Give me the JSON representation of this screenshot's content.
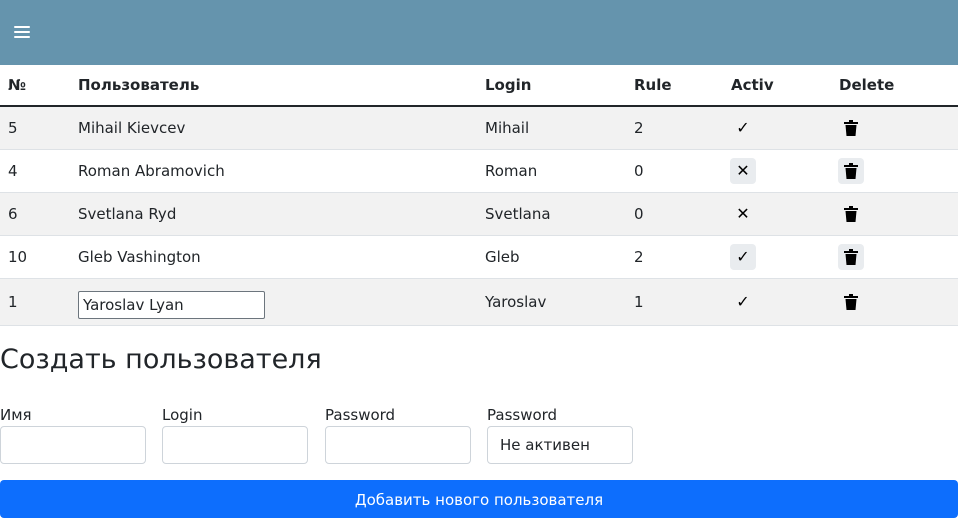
{
  "colors": {
    "topbar": "#6594ad",
    "primary": "#0d6efd",
    "stripe": "#f2f2f2"
  },
  "header": {
    "menu_icon": "hamburger-icon"
  },
  "table": {
    "columns": [
      "№",
      "Пользователь",
      "Login",
      "Rule",
      "Activ",
      "Delete"
    ],
    "rows": [
      {
        "id": "5",
        "user": "Mihail Kievcev",
        "login": "Mihail",
        "rule": "2",
        "active": "check-icon"
      },
      {
        "id": "4",
        "user": "Roman Abramovich",
        "login": "Roman",
        "rule": "0",
        "active": "cross-icon"
      },
      {
        "id": "6",
        "user": "Svetlana Ryd",
        "login": "Svetlana",
        "rule": "0",
        "active": "cross-icon"
      },
      {
        "id": "10",
        "user": "Gleb Vashington",
        "login": "Gleb",
        "rule": "2",
        "active": "check-icon"
      },
      {
        "id": "1",
        "user": "Yaroslav Lyan",
        "login": "Yaroslav",
        "rule": "1",
        "active": "check-icon",
        "editing": true
      }
    ]
  },
  "create": {
    "title": "Создать пользователя",
    "fields": [
      {
        "label": "Имя",
        "value": ""
      },
      {
        "label": "Login",
        "value": ""
      },
      {
        "label": "Password",
        "value": ""
      },
      {
        "label": "Password",
        "value": "Не активен"
      }
    ],
    "submit_label": "Добавить нового пользователя"
  }
}
